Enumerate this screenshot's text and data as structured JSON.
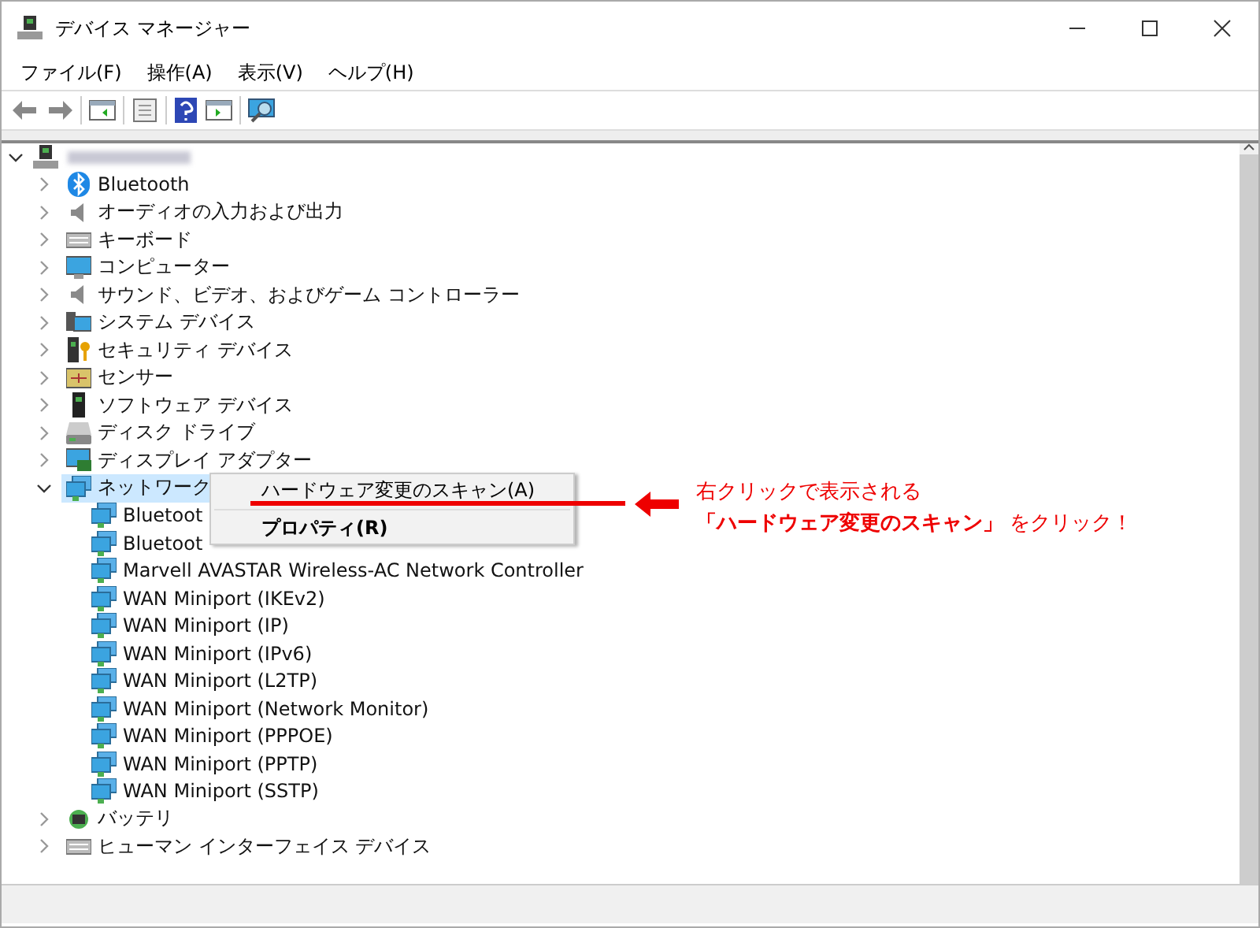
{
  "window": {
    "title": "デバイス マネージャー"
  },
  "menu": [
    "ファイル(F)",
    "操作(A)",
    "表示(V)",
    "ヘルプ(H)"
  ],
  "tree": {
    "root": {
      "expanded": true,
      "selected": false,
      "children": [
        {
          "label": "Bluetooth",
          "kind": "bluetooth",
          "expanded": false,
          "selected": false
        },
        {
          "label": "オーディオの入力および出力",
          "kind": "speaker",
          "expanded": false,
          "selected": false
        },
        {
          "label": "キーボード",
          "kind": "keyboard",
          "expanded": false,
          "selected": false
        },
        {
          "label": "コンピューター",
          "kind": "monitor",
          "expanded": false,
          "selected": false
        },
        {
          "label": "サウンド、ビデオ、およびゲーム コントローラー",
          "kind": "speaker",
          "expanded": false,
          "selected": false
        },
        {
          "label": "システム デバイス",
          "kind": "system",
          "expanded": false,
          "selected": false
        },
        {
          "label": "セキュリティ デバイス",
          "kind": "security",
          "expanded": false,
          "selected": false
        },
        {
          "label": "センサー",
          "kind": "sensor",
          "expanded": false,
          "selected": false
        },
        {
          "label": "ソフトウェア デバイス",
          "kind": "software",
          "expanded": false,
          "selected": false
        },
        {
          "label": "ディスク ドライブ",
          "kind": "disk",
          "expanded": false,
          "selected": false
        },
        {
          "label": "ディスプレイ アダプター",
          "kind": "display",
          "expanded": false,
          "selected": false
        },
        {
          "label": "ネットワーク",
          "kind": "network",
          "expanded": true,
          "selected": true,
          "children": [
            {
              "label": "Bluetoot",
              "kind": "network",
              "selected": false
            },
            {
              "label": "Bluetoot",
              "kind": "network",
              "selected": false
            },
            {
              "label": "Marvell AVASTAR Wireless-AC Network Controller",
              "kind": "network",
              "selected": false
            },
            {
              "label": "WAN Miniport (IKEv2)",
              "kind": "network",
              "selected": false
            },
            {
              "label": "WAN Miniport (IP)",
              "kind": "network",
              "selected": false
            },
            {
              "label": "WAN Miniport (IPv6)",
              "kind": "network",
              "selected": false
            },
            {
              "label": "WAN Miniport (L2TP)",
              "kind": "network",
              "selected": false
            },
            {
              "label": "WAN Miniport (Network Monitor)",
              "kind": "network",
              "selected": false
            },
            {
              "label": "WAN Miniport (PPPOE)",
              "kind": "network",
              "selected": false
            },
            {
              "label": "WAN Miniport (PPTP)",
              "kind": "network",
              "selected": false
            },
            {
              "label": "WAN Miniport (SSTP)",
              "kind": "network",
              "selected": false
            }
          ]
        },
        {
          "label": "バッテリ",
          "kind": "battery",
          "expanded": false,
          "selected": false
        },
        {
          "label": "ヒューマン インターフェイス デバイス",
          "kind": "keyboard",
          "expanded": false,
          "selected": false
        }
      ]
    }
  },
  "context_menu": {
    "items": [
      {
        "label": "ハードウェア変更のスキャン(A)",
        "bold": false
      },
      {
        "label": "プロパティ(R)",
        "bold": true
      }
    ]
  },
  "annotation": {
    "lines": [
      "右クリックで表示される",
      "**「ハードウェア変更のスキャン」** をクリック！"
    ]
  }
}
